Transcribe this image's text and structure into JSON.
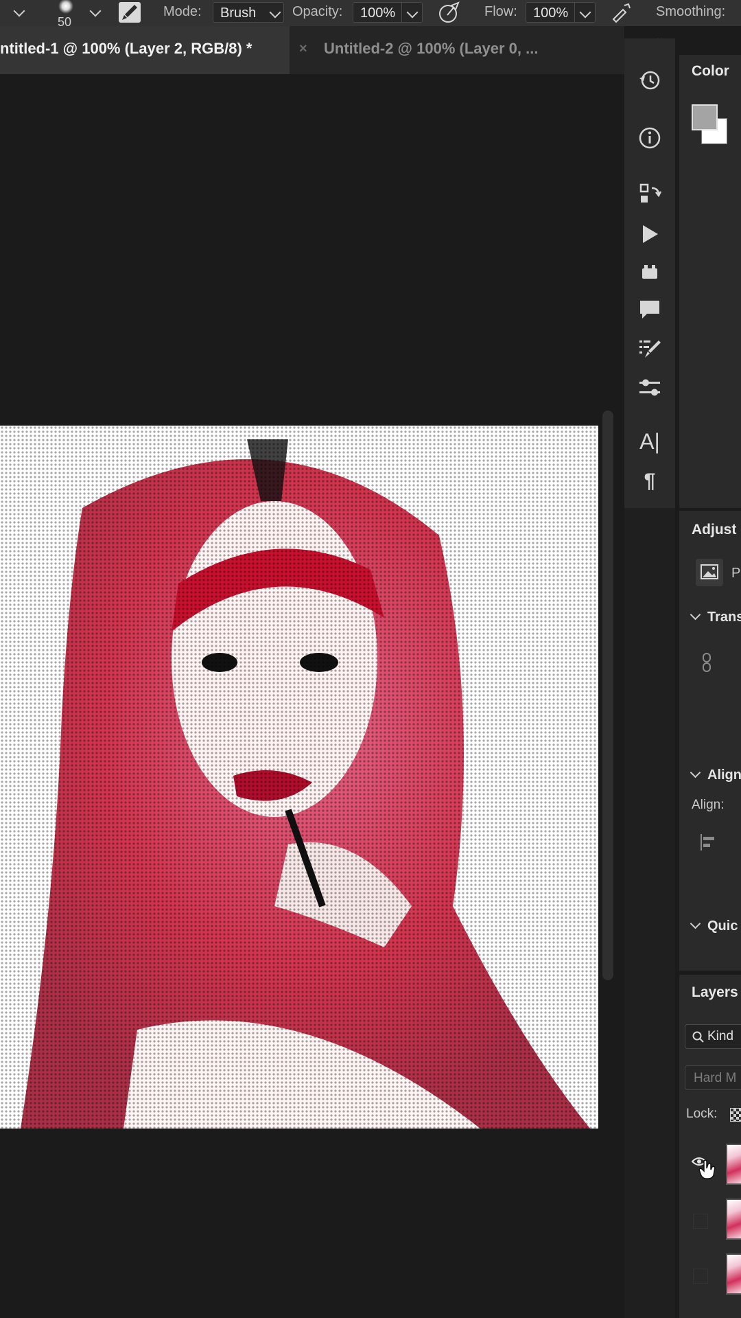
{
  "options_bar": {
    "brush_size": "50",
    "mode_label": "Mode:",
    "mode_value": "Brush",
    "opacity_label": "Opacity:",
    "opacity_value": "100%",
    "flow_label": "Flow:",
    "flow_value": "100%",
    "smoothing_label": "Smoothing:"
  },
  "tabs": [
    {
      "label": "ntitled-1 @ 100% (Layer 2, RGB/8) *"
    },
    {
      "label": "Untitled-2 @ 100% (Layer 0, ..."
    }
  ],
  "panel_icons": [
    "history-icon",
    "info-icon",
    "swap-icon",
    "play-icon",
    "plugin-icon",
    "comment-icon",
    "brush-settings-icon",
    "adjust-icon",
    "character-icon",
    "paragraph-icon"
  ],
  "right_panels": {
    "color_title": "Color",
    "foreground_color": "#a4a4a4",
    "background_color": "#ffffff",
    "adjustments_title": "Adjust",
    "adjust_item_label": "P",
    "transform_section": "Trans",
    "align_section": "Align",
    "align_label": "Align:",
    "quick_section": "Quic",
    "layers_title": "Layers",
    "search_kind": "Kind",
    "blend_mode": "Hard M",
    "lock_label": "Lock:"
  },
  "colors": {
    "canvas_bg": "#1b1b1b",
    "toolbar_bg": "#323232",
    "panel_bg": "#2a2a2a",
    "accent_red": "#c8102e"
  }
}
